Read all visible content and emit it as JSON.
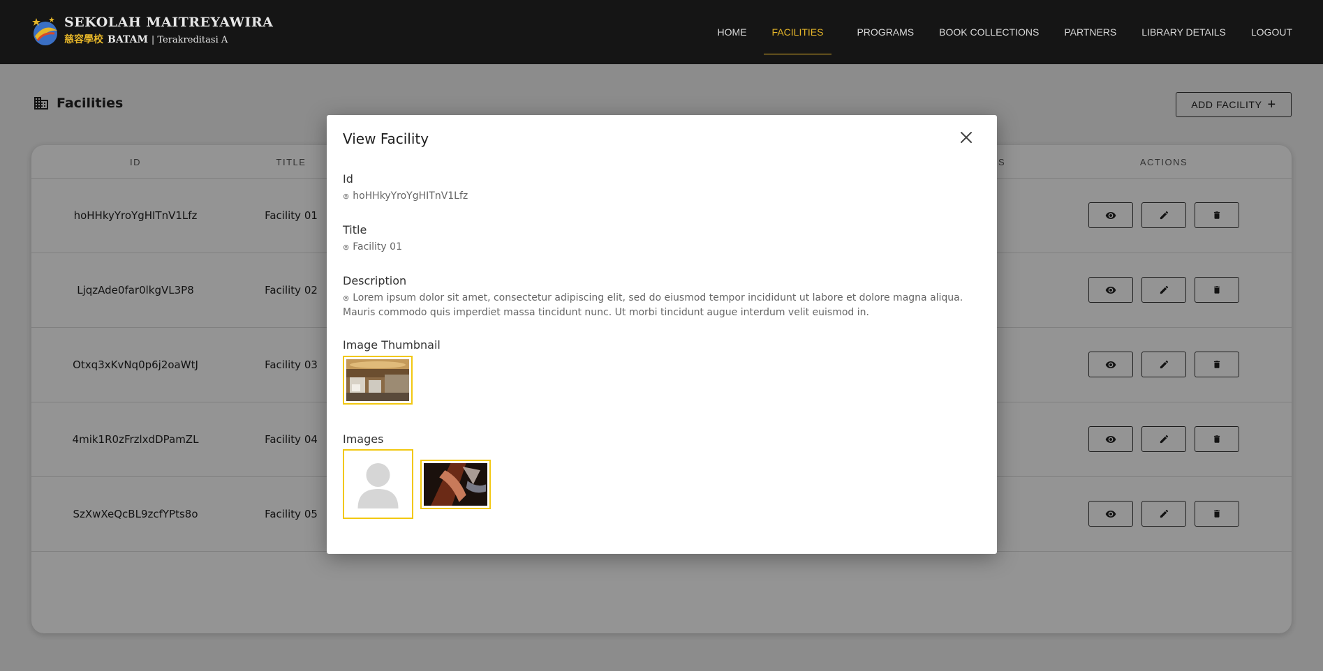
{
  "header": {
    "logo_line1": "SEKOLAH MAITREYAWIRA",
    "logo_cjk": "慈容學校",
    "logo_city": "BATAM",
    "logo_accreditation": "| Terakreditasi A",
    "nav": [
      "HOME",
      "FACILITIES",
      "PROGRAMS",
      "BOOK COLLECTIONS",
      "PARTNERS",
      "LIBRARY DETAILS",
      "LOGOUT"
    ],
    "active_nav": "FACILITIES",
    "accent_color": "#e6b629"
  },
  "page": {
    "title": "Facilities",
    "add_button": "ADD FACILITY",
    "add_icon": "plus-icon",
    "columns": [
      "ID",
      "TITLE",
      "",
      "",
      "ES",
      "ACTIONS"
    ],
    "rows": [
      {
        "id": "hoHHkyYroYgHITnV1Lfz",
        "title": "Facility 01"
      },
      {
        "id": "LjqzAde0far0lkgVL3P8",
        "title": "Facility 02"
      },
      {
        "id": "Otxq3xKvNq0p6j2oaWtJ",
        "title": "Facility 03"
      },
      {
        "id": "4mik1R0zFrzlxdDPamZL",
        "title": "Facility 04"
      },
      {
        "id": "SzXwXeQcBL9zcfYPts8o",
        "title": "Facility 05"
      }
    ],
    "row_actions": [
      "eye-icon",
      "pencil-icon",
      "trash-icon"
    ]
  },
  "modal": {
    "title": "View Facility",
    "close_icon": "close-icon",
    "id_label": "Id",
    "id_value": "hoHHkyYroYgHITnV1Lfz",
    "title_label": "Title",
    "title_value": "Facility 01",
    "description_label": "Description",
    "description_value": "Lorem ipsum dolor sit amet, consectetur adipiscing elit, sed do eiusmod tempor incididunt ut labore et dolore magna aliqua. Mauris commodo quis imperdiet massa tincidunt nunc. Ut morbi tincidunt augue interdum velit euismod in.",
    "thumbnail_label": "Image Thumbnail",
    "images_label": "Images",
    "frame_color": "#f2c811"
  }
}
